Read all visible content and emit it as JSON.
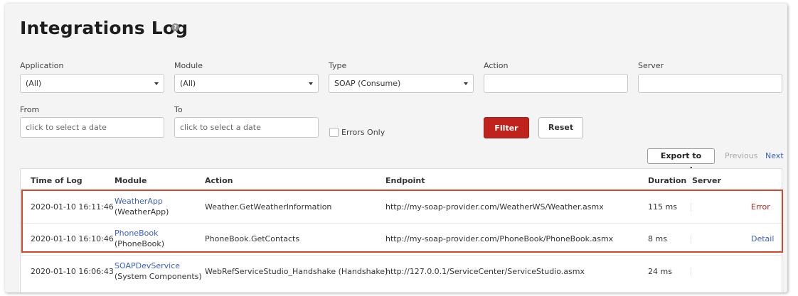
{
  "page": {
    "title": "Integrations Log",
    "help_icon": "?"
  },
  "filters": {
    "application": {
      "label": "Application",
      "value": "(All)"
    },
    "module": {
      "label": "Module",
      "value": "(All)"
    },
    "type": {
      "label": "Type",
      "value": "SOAP (Consume)"
    },
    "action": {
      "label": "Action",
      "value": ""
    },
    "server": {
      "label": "Server",
      "value": ""
    },
    "from": {
      "label": "From",
      "placeholder": "click to select a date"
    },
    "to": {
      "label": "To",
      "placeholder": "click to select a date"
    },
    "errors_only": {
      "label": "Errors Only",
      "checked": false
    },
    "filter_button": "Filter",
    "reset_button": "Reset"
  },
  "toolbar": {
    "export_button": "Export to excel",
    "previous": "Previous",
    "next": "Next"
  },
  "table": {
    "columns": [
      "Time of Log",
      "Module",
      "Action",
      "Endpoint",
      "Duration",
      "Server"
    ],
    "rows": [
      {
        "time": "2020-01-10 16:11:46",
        "module": "WeatherApp",
        "module_sub": "(WeatherApp)",
        "action": "Weather.GetWeatherInformation",
        "endpoint": "http://my-soap-provider.com/WeatherWS/Weather.asmx",
        "duration": "115 ms",
        "server": "",
        "status": "Error"
      },
      {
        "time": "2020-01-10 16:10:46",
        "module": "PhoneBook",
        "module_sub": "(PhoneBook)",
        "action": "PhoneBook.GetContacts",
        "endpoint": "http://my-soap-provider.com/PhoneBook/PhoneBook.asmx",
        "duration": "8 ms",
        "server": "",
        "status": "Detail"
      },
      {
        "time": "2020-01-10 16:06:43",
        "module": "SOAPDevService",
        "module_sub": "(System Components)",
        "action": "WebRefServiceStudio_Handshake (Handshake)",
        "endpoint": "http://127.0.0.1/ServiceCenter/ServiceStudio.asmx",
        "duration": "24 ms",
        "server": "",
        "status": ""
      }
    ]
  },
  "colors": {
    "accent_red": "#c0231b",
    "link_blue": "#3b5fc4",
    "highlight": "#d6462b"
  }
}
